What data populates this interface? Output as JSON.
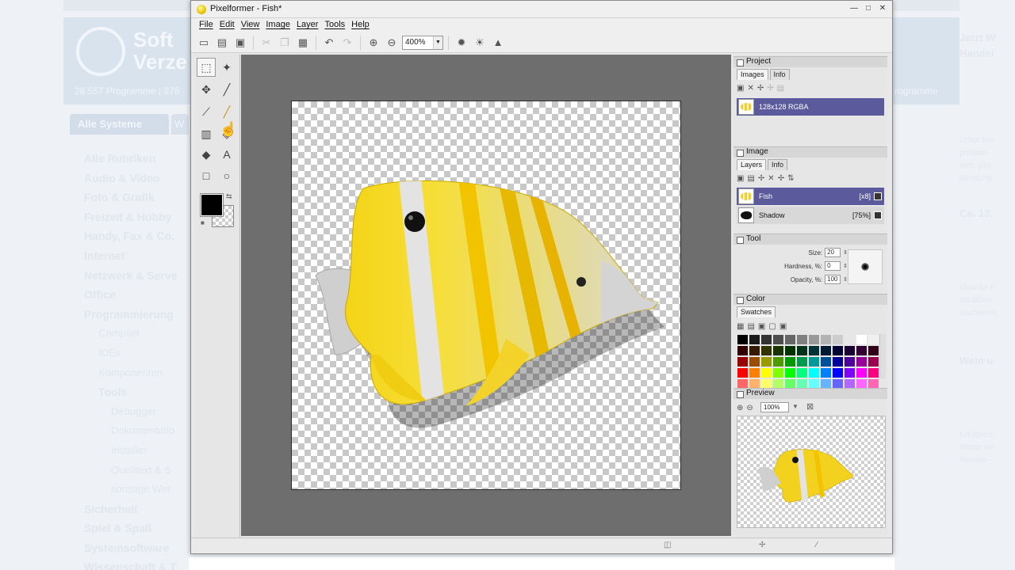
{
  "background_site": {
    "brand_line1": "Soft",
    "brand_line2": "Verze",
    "stats": "28.557 Programme | 875",
    "stats_right": "rogramme",
    "tab_active": "Alle Systeme",
    "tab_next": "W",
    "nav": [
      "Alle Rubriken",
      "Audio & Video",
      "Foto & Grafik",
      "Freizeit & Hobby",
      "Handy, Fax & Co.",
      "Internet",
      "Netzwerk & Serve",
      "Office",
      "Programmierung",
      "Compiler",
      "IDEs",
      "Komponenten",
      "Tools",
      "Debugger",
      "Dokumentatio",
      "Installer",
      "Quelltext & S",
      "sonstige Wer",
      "Sicherheit",
      "Spiel & Spaß",
      "Systemsoftware",
      "Wissenschaft & T"
    ],
    "right": [
      "Jetzt W",
      "Handel",
      "LYNX Bro",
      "professi",
      "sehr gün",
      "Beratung",
      "Ca. 13.",
      "Ideal für F",
      "attraktive",
      "Sachwerte",
      "Wein u",
      "Erfolgreic",
      "Weste inv",
      "Rendite -"
    ]
  },
  "window": {
    "title": "Pixelformer - Fish*",
    "controls": [
      "—",
      "□",
      "✕"
    ]
  },
  "menu": [
    "File",
    "Edit",
    "View",
    "Image",
    "Layer",
    "Tools",
    "Help"
  ],
  "toolbar": {
    "zoom": "400%",
    "icons": [
      "new-icon",
      "open-icon",
      "save-icon",
      "cut-icon",
      "copy-icon",
      "paste-icon",
      "undo-icon",
      "redo-icon",
      "zoom-in-icon",
      "zoom-out-icon",
      "brightness-icon",
      "contrast-icon",
      "triangle-icon"
    ]
  },
  "tools": [
    "marquee",
    "magic-wand",
    "move",
    "eyedropper",
    "line",
    "brush",
    "gradient",
    "fill",
    "eraser",
    "text",
    "rectangle",
    "ellipse"
  ],
  "colors": {
    "foreground": "#000000",
    "background": "transparent"
  },
  "project_panel": {
    "title": "Project",
    "tabs": [
      "Images",
      "Info"
    ],
    "image_item": "128x128 RGBA"
  },
  "image_panel": {
    "title": "Image",
    "tabs": [
      "Layers",
      "Info"
    ],
    "layers": [
      {
        "name": "Fish",
        "opacity": "[x8]"
      },
      {
        "name": "Shadow",
        "opacity": "[75%]"
      }
    ]
  },
  "tool_panel": {
    "title": "Tool",
    "size_label": "Size:",
    "size_value": "20",
    "hardness_label": "Hardness, %:",
    "hardness_value": "0",
    "opacity_label": "Opacity, %:",
    "opacity_value": "100"
  },
  "color_panel": {
    "title": "Color",
    "tabs": [
      "Swatches"
    ],
    "swatches": [
      "#000000",
      "#1a1a1a",
      "#333333",
      "#4d4d4d",
      "#666666",
      "#808080",
      "#999999",
      "#b3b3b3",
      "#cccccc",
      "#e6e6e6",
      "#ffffff",
      "#f0f0f0",
      "#330000",
      "#331a00",
      "#333300",
      "#1a3300",
      "#003300",
      "#00331a",
      "#003333",
      "#001a33",
      "#000033",
      "#1a0033",
      "#330033",
      "#33001a",
      "#990000",
      "#994d00",
      "#999900",
      "#4d9900",
      "#009900",
      "#00994d",
      "#009999",
      "#004d99",
      "#000099",
      "#4d0099",
      "#990099",
      "#99004d",
      "#ff0000",
      "#ff8000",
      "#ffff00",
      "#80ff00",
      "#00ff00",
      "#00ff80",
      "#00ffff",
      "#0080ff",
      "#0000ff",
      "#8000ff",
      "#ff00ff",
      "#ff0080",
      "#ff6666",
      "#ffb366",
      "#ffff66",
      "#b3ff66",
      "#66ff66",
      "#66ffb3",
      "#66ffff",
      "#66b3ff",
      "#6666ff",
      "#b366ff",
      "#ff66ff",
      "#ff66b3"
    ]
  },
  "preview_panel": {
    "title": "Preview",
    "zoom": "100%"
  }
}
